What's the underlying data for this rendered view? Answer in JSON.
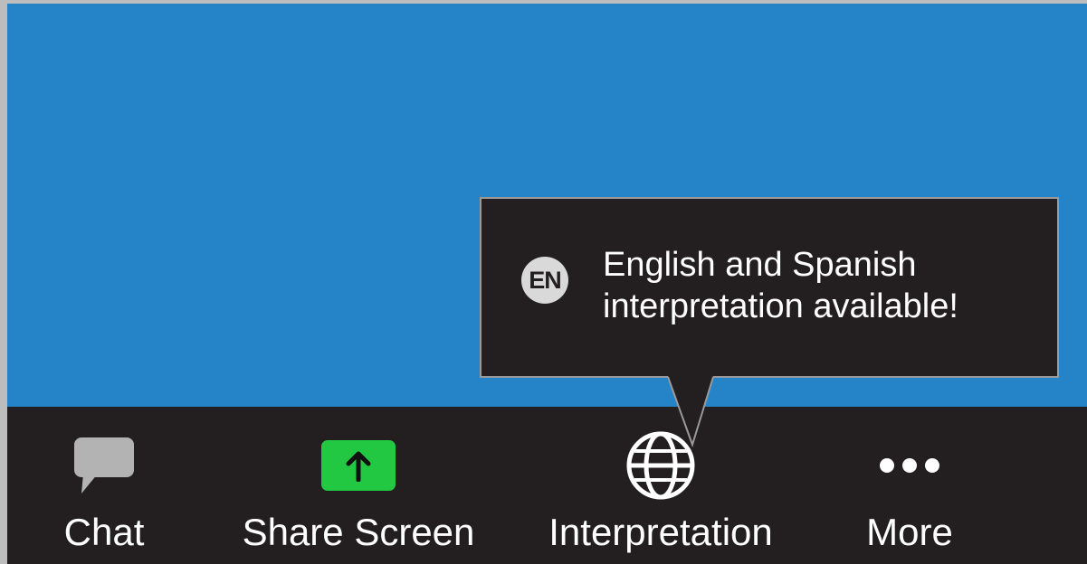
{
  "toolbar": {
    "chat_label": "Chat",
    "share_label": "Share Screen",
    "interpretation_label": "Interpretation",
    "more_label": "More"
  },
  "tooltip": {
    "badge": "EN",
    "line1": "English and Spanish",
    "line2": "interpretation available!"
  },
  "icons": {
    "chat": "chat-bubble-icon",
    "share": "share-screen-arrow-icon",
    "interpretation": "globe-icon",
    "more": "ellipsis-icon"
  },
  "colors": {
    "video_background": "#2584c8",
    "toolbar_background": "#231f20",
    "share_green": "#22c742",
    "chat_icon_gray": "#b3b3b3",
    "tooltip_border": "#9a9a9a"
  }
}
